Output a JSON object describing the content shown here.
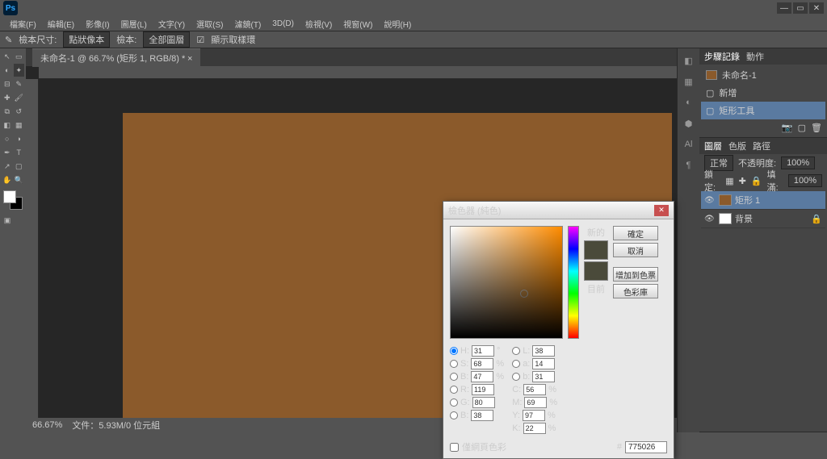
{
  "app": {
    "logo": "Ps"
  },
  "window_controls": {
    "min": "—",
    "max": "▭",
    "close": "✕"
  },
  "menu": [
    "檔案(F)",
    "編輯(E)",
    "影像(I)",
    "圖層(L)",
    "文字(Y)",
    "選取(S)",
    "濾鏡(T)",
    "3D(D)",
    "檢視(V)",
    "視窗(W)",
    "說明(H)"
  ],
  "options": {
    "size_label": "檢本尺寸:",
    "size_value": "點狀像本",
    "sample_label": "檢本:",
    "sample_value": "全部圖層",
    "show_ring": "顯示取樣環"
  },
  "tab": {
    "title": "未命名-1 @ 66.7% (矩形 1, RGB/8) *",
    "close": "×"
  },
  "status": {
    "zoom": "66.67%",
    "doc": "文件：5.93M/0 位元組"
  },
  "history_panel": {
    "tabs": [
      "步驟記錄",
      "動作"
    ],
    "doc": "未命名-1",
    "items": [
      "新增",
      "矩形工具"
    ]
  },
  "layers_panel": {
    "tabs": [
      "圖層",
      "色版",
      "路徑"
    ],
    "blend": "正常",
    "opacity_label": "不透明度:",
    "opacity": "100%",
    "lock_label": "鎖定:",
    "fill_label": "填滿:",
    "fill": "100%",
    "layers": [
      {
        "name": "矩形 1",
        "color": "#8b5a2b"
      },
      {
        "name": "背景",
        "color": "#fff"
      }
    ]
  },
  "color_picker": {
    "title": "檢色器 (純色)",
    "new_label": "新的",
    "current_label": "目前",
    "ok": "確定",
    "cancel": "取消",
    "add_swatch": "增加到色票",
    "libraries": "色彩庫",
    "only_web": "僅網頁色彩",
    "hex_label": "#",
    "hex": "775026",
    "H": "31",
    "S": "68",
    "Bv": "47",
    "R": "119",
    "G": "80",
    "B": "38",
    "L": "38",
    "a": "14",
    "b": "31",
    "C": "56",
    "M": "69",
    "Y": "97",
    "K": "22"
  }
}
